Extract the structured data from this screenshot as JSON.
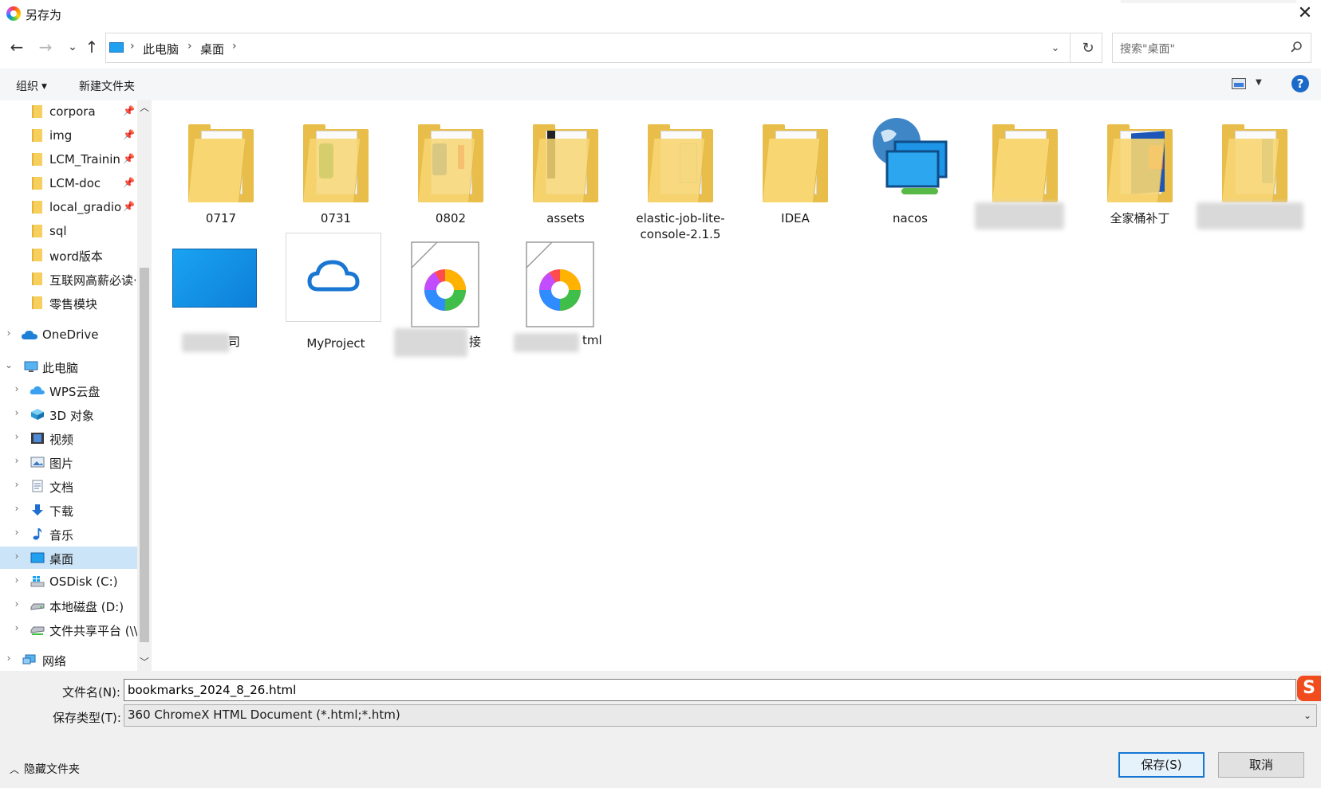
{
  "window": {
    "title": "另存为",
    "close": "✕"
  },
  "nav": {
    "back": "←",
    "forward": "→",
    "recent": "⌄",
    "up": "↑",
    "breadcrumb": [
      "此电脑",
      "桌面"
    ],
    "sep": "›",
    "refresh": "↻",
    "search_placeholder": "搜索\"桌面\""
  },
  "toolbar": {
    "organize": "组织",
    "new_folder": "新建文件夹",
    "help": "?"
  },
  "tree": {
    "quick": [
      {
        "label": "corpora",
        "pin": true
      },
      {
        "label": "img",
        "pin": true
      },
      {
        "label": "LCM_Trainin",
        "pin": true
      },
      {
        "label": "LCM-doc",
        "pin": true
      },
      {
        "label": "local_gradio",
        "pin": true
      },
      {
        "label": "sql",
        "pin": false
      },
      {
        "label": "word版本",
        "pin": false
      },
      {
        "label": "互联网高薪必读·",
        "pin": false
      },
      {
        "label": "零售模块",
        "pin": false
      }
    ],
    "onedrive": "OneDrive",
    "thispc": "此电脑",
    "pc_children": [
      "WPS云盘",
      "3D 对象",
      "视频",
      "图片",
      "文档",
      "下载",
      "音乐",
      "桌面",
      "OSDisk (C:)",
      "本地磁盘 (D:)",
      "文件共享平台 (\\\\"
    ],
    "network": "网络",
    "selected": "桌面"
  },
  "files": [
    {
      "name": "0717",
      "type": "folder"
    },
    {
      "name": "0731",
      "type": "folder"
    },
    {
      "name": "0802",
      "type": "folder"
    },
    {
      "name": "assets",
      "type": "folder"
    },
    {
      "name": "elastic-job-lite-console-2.1.5",
      "type": "folder"
    },
    {
      "name": "IDEA",
      "type": "folder"
    },
    {
      "name": "nacos",
      "type": "network"
    },
    {
      "name": "",
      "type": "folder"
    },
    {
      "name": "全家桶补丁",
      "type": "folder"
    },
    {
      "name": "",
      "type": "folder"
    },
    {
      "name": "司",
      "type": "desktop"
    },
    {
      "name": "MyProject",
      "type": "cloud"
    },
    {
      "name": "接",
      "type": "html"
    },
    {
      "name": "tml",
      "type": "html"
    }
  ],
  "bottom": {
    "filename_label": "文件名(N):",
    "filename_value": "bookmarks_2024_8_26.html",
    "filetype_label": "保存类型(T):",
    "filetype_value": "360 ChromeX HTML Document (*.html;*.htm)",
    "hide_folders": "隐藏文件夹",
    "save": "保存(S)",
    "cancel": "取消",
    "ime_badge": "S"
  },
  "colors": {
    "accent": "#1677d2",
    "selected": "#cce4f7",
    "folder": "#f8d672"
  }
}
